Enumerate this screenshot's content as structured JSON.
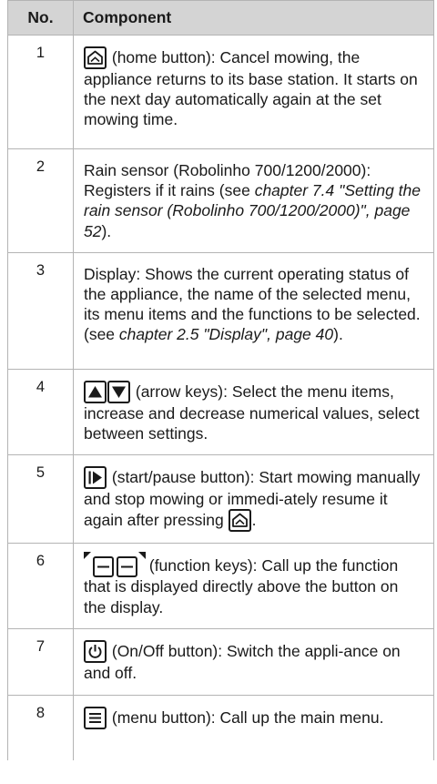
{
  "table": {
    "header_no": "No.",
    "header_component": "Component"
  },
  "rows": [
    {
      "num": "1",
      "icon": "home-icon",
      "text": " (home button): Cancel mowing, the appliance returns to its base station. It starts on the next day automatically again at the set mowing time."
    },
    {
      "num": "2",
      "text_a": "Rain sensor (Robolinho 700/1200/2000): Registers if it rains (see ",
      "ref": "chapter 7.4 \"Setting the rain sensor (Robolinho 700/1200/2000)\", page 52",
      "text_b": ")."
    },
    {
      "num": "3",
      "text_a": "Display: Shows the current operating status of the appliance, the name of the selected menu, its menu items and the functions to be selected. (see ",
      "ref": "chapter 2.5 \"Display\", page 40",
      "text_b": ")."
    },
    {
      "num": "4",
      "icons": [
        "arrow-up-icon",
        "arrow-down-icon"
      ],
      "text": " (arrow keys): Select the menu items, increase and decrease numerical values, select between settings."
    },
    {
      "num": "5",
      "icon": "play-pause-icon",
      "text_a": " (start/pause button): Start mowing manually and stop mowing or immedi-ately resume it again after pressing ",
      "icon_end": "home-icon",
      "text_b": "."
    },
    {
      "num": "6",
      "icons": [
        "function-key-left-icon",
        "function-key-right-icon"
      ],
      "text": " (function keys): Call up the function that is displayed directly above the button on the display."
    },
    {
      "num": "7",
      "icon": "power-icon",
      "text": " (On/Off button): Switch the appli-ance on and off."
    },
    {
      "num": "8",
      "icon": "menu-icon",
      "text": " (menu button): Call up the main menu."
    }
  ]
}
